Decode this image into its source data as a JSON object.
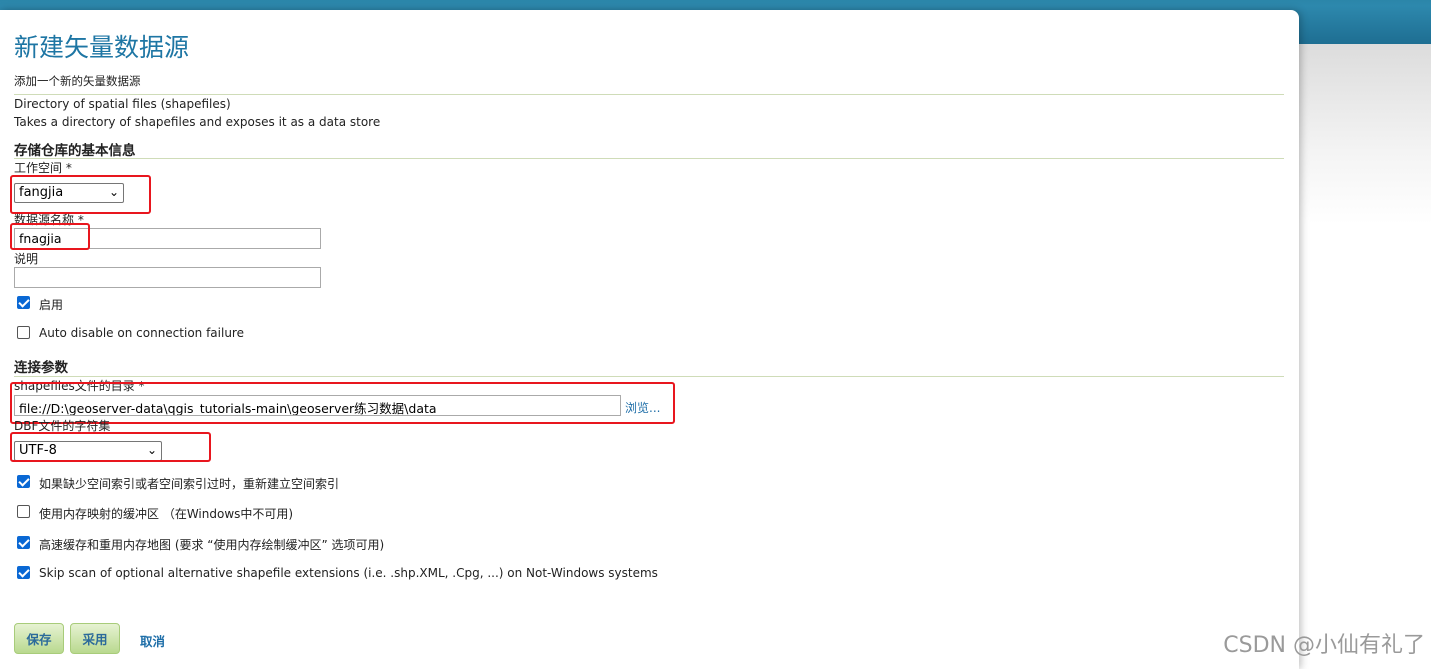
{
  "header": {
    "title": "新建矢量数据源",
    "subtitle": "添加一个新的矢量数据源"
  },
  "datasource": {
    "type_name": "Directory of spatial files (shapefiles)",
    "type_desc": "Takes a directory of shapefiles and exposes it as a data store"
  },
  "basic": {
    "section_title": "存储仓库的基本信息",
    "workspace_label": "工作空间 *",
    "workspace_value": "fangjia",
    "name_label": "数据源名称 *",
    "name_value": "fnagjia",
    "desc_label": "说明",
    "desc_value": "",
    "enabled_label": "启用",
    "enabled_checked": true,
    "auto_disable_label": "Auto disable on connection failure",
    "auto_disable_checked": false
  },
  "connection": {
    "section_title": "连接参数",
    "dir_label": "shapefiles文件的目录 *",
    "dir_value": "file://D:\\geoserver-data\\qgis_tutorials-main\\geoserver练习数据\\data",
    "browse_label": "浏览...",
    "charset_label": "DBF文件的字符集",
    "charset_value": "UTF-8",
    "options": [
      {
        "label": "如果缺少空间索引或者空间索引过时，重新建立空间索引",
        "checked": true
      },
      {
        "label": "使用内存映射的缓冲区 （在Windows中不可用)",
        "checked": false
      },
      {
        "label": "高速缓存和重用内存地图 (要求 “使用内存绘制缓冲区” 选项可用)",
        "checked": true
      },
      {
        "label": "Skip scan of optional alternative shapefile extensions (i.e. .shp.XML, .Cpg, ...) on Not-Windows systems",
        "checked": true
      }
    ]
  },
  "actions": {
    "save_label": "保存",
    "apply_label": "采用",
    "cancel_label": "取消"
  },
  "watermark": "CSDN @小仙有礼了",
  "colors": {
    "accent": "#1e76a4",
    "highlight_box": "#e8161e",
    "button_green": "#b9d98f"
  }
}
